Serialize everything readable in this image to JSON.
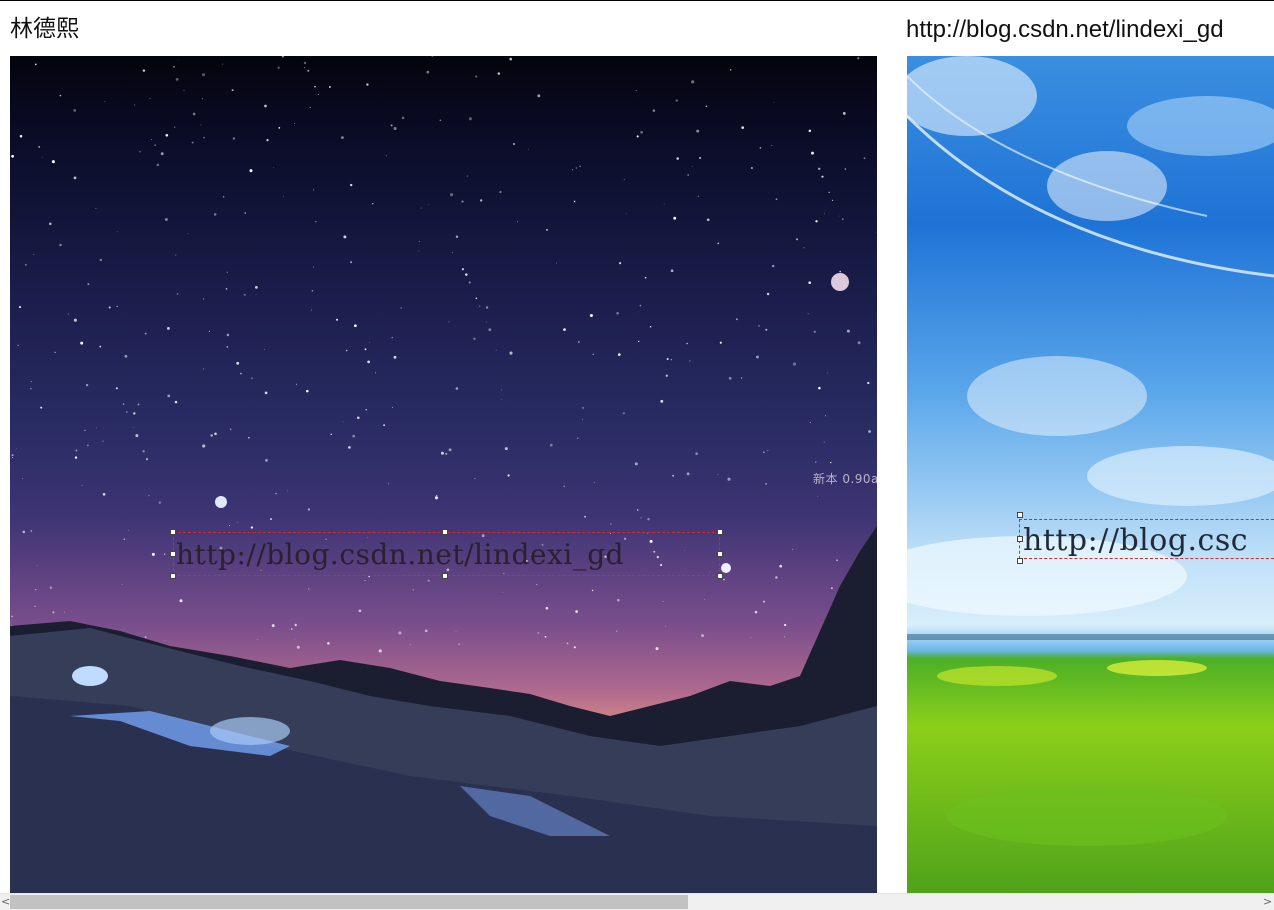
{
  "header": {
    "author": "林德熙",
    "blog_url": "http://blog.csdn.net/lindexi_gd"
  },
  "night_image": {
    "watermark_text": "http://blog.csdn.net/lindexi_gd",
    "corner_text": "新本 0.90a"
  },
  "sky_image": {
    "watermark_text": "http://blog.csc"
  },
  "scrollbar": {
    "left_arrow": "<",
    "right_arrow": ">"
  },
  "colors": {
    "selection_border": "#d22a2a",
    "scroll_thumb": "#c2c2c2"
  }
}
